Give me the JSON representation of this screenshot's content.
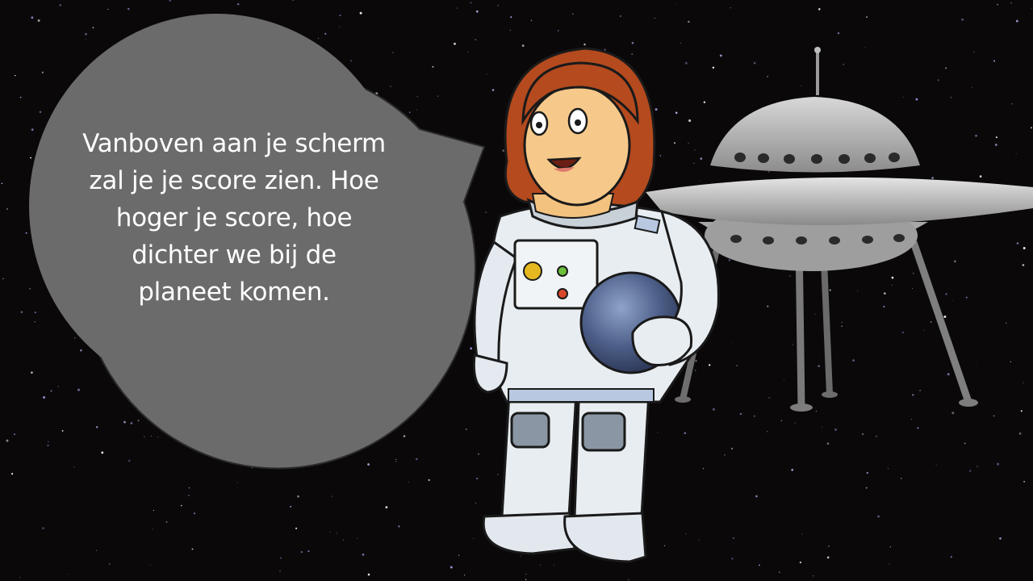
{
  "speech_bubble": {
    "text": "Vanboven aan je scherm\nzal je je score zien. Hoe\nhoger je score, hoe\ndichter we bij de\nplaneet komen."
  },
  "colors": {
    "space_background": "#0b0809",
    "bubble_fill": "#6b6b6b",
    "bubble_text": "#ffffff",
    "astronaut_hair": "#b44a1e",
    "spacesuit": "#e8edf1",
    "ufo_hull": "#b9b9b9"
  },
  "icons": {
    "character": "astronaut-girl",
    "vehicle": "flying-saucer"
  }
}
